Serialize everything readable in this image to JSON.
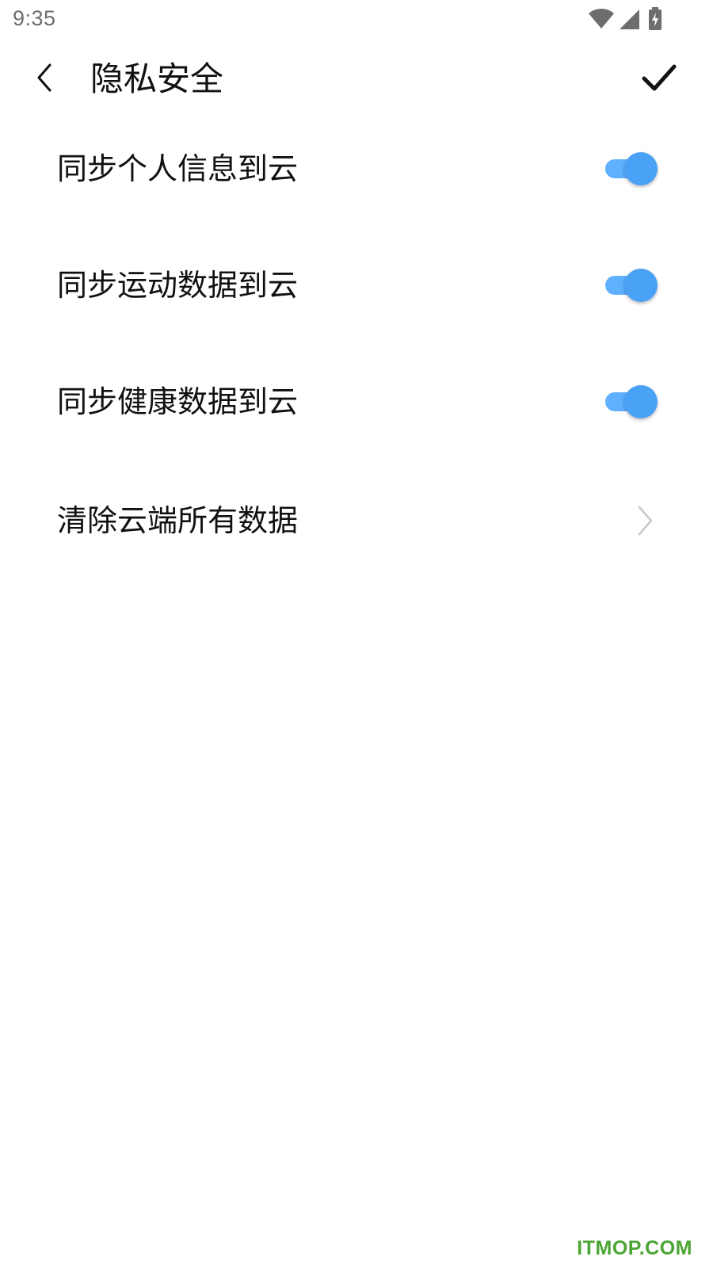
{
  "status_bar": {
    "time": "9:35",
    "icons": [
      "wifi-icon",
      "signal-icon",
      "battery-charging-icon"
    ],
    "icon_color": "#6d6d6d"
  },
  "toolbar": {
    "back_icon": "chevron-left-icon",
    "title": "隐私安全",
    "confirm_icon": "checkmark-icon"
  },
  "settings": [
    {
      "label": "同步个人信息到云",
      "type": "toggle",
      "checked": true
    },
    {
      "label": "同步运动数据到云",
      "type": "toggle",
      "checked": true
    },
    {
      "label": "同步健康数据到云",
      "type": "toggle",
      "checked": true
    },
    {
      "label": "清除云端所有数据",
      "type": "link",
      "icon": "chevron-right-icon"
    }
  ],
  "accent_color": "#4aa2f6",
  "watermark": {
    "text": "ITMOP.COM",
    "color": "#4aa532"
  }
}
